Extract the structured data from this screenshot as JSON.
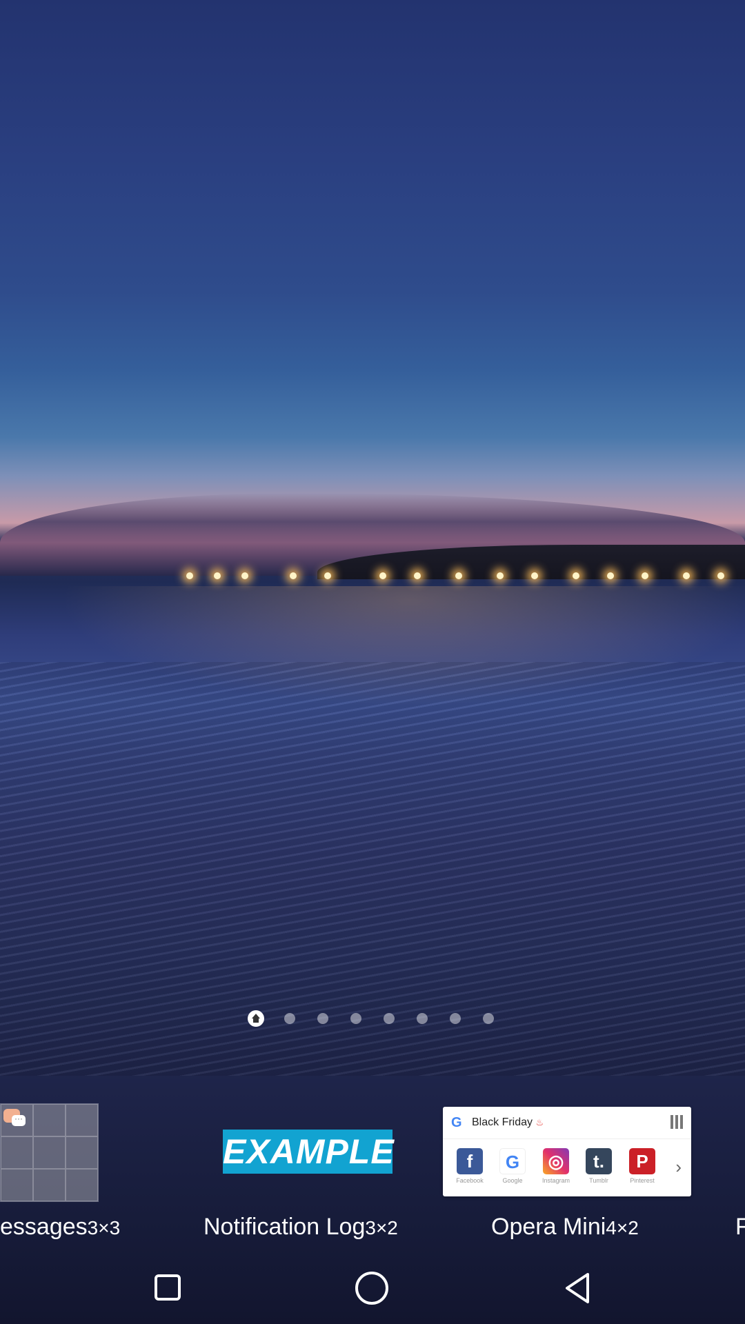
{
  "page_indicator": {
    "total_pages": 8,
    "current_page": 1,
    "home_page": 1
  },
  "widgets": [
    {
      "name": "essages",
      "size": "3×3"
    },
    {
      "name": "Notification Log",
      "size": "3×2",
      "preview_text": "EXAMPLE"
    },
    {
      "name": "Opera Mini",
      "size": "4×2"
    },
    {
      "name": "F",
      "size": ""
    }
  ],
  "opera_widget": {
    "search_text": "Black Friday",
    "apps": [
      {
        "label": "Facebook",
        "icon": "facebook-icon",
        "color": "#3b5998",
        "glyph": "f"
      },
      {
        "label": "Google",
        "icon": "google-icon",
        "color": "#ffffff",
        "glyph": "G"
      },
      {
        "label": "Instagram",
        "icon": "instagram-icon",
        "color": "#c13584",
        "glyph": "◎"
      },
      {
        "label": "Tumblr",
        "icon": "tumblr-icon",
        "color": "#35465c",
        "glyph": "t."
      },
      {
        "label": "Pinterest",
        "icon": "pinterest-icon",
        "color": "#cb2027",
        "glyph": "P"
      }
    ]
  },
  "navbar": {
    "recent": "recent-apps-icon",
    "home": "home-icon",
    "back": "back-icon"
  }
}
